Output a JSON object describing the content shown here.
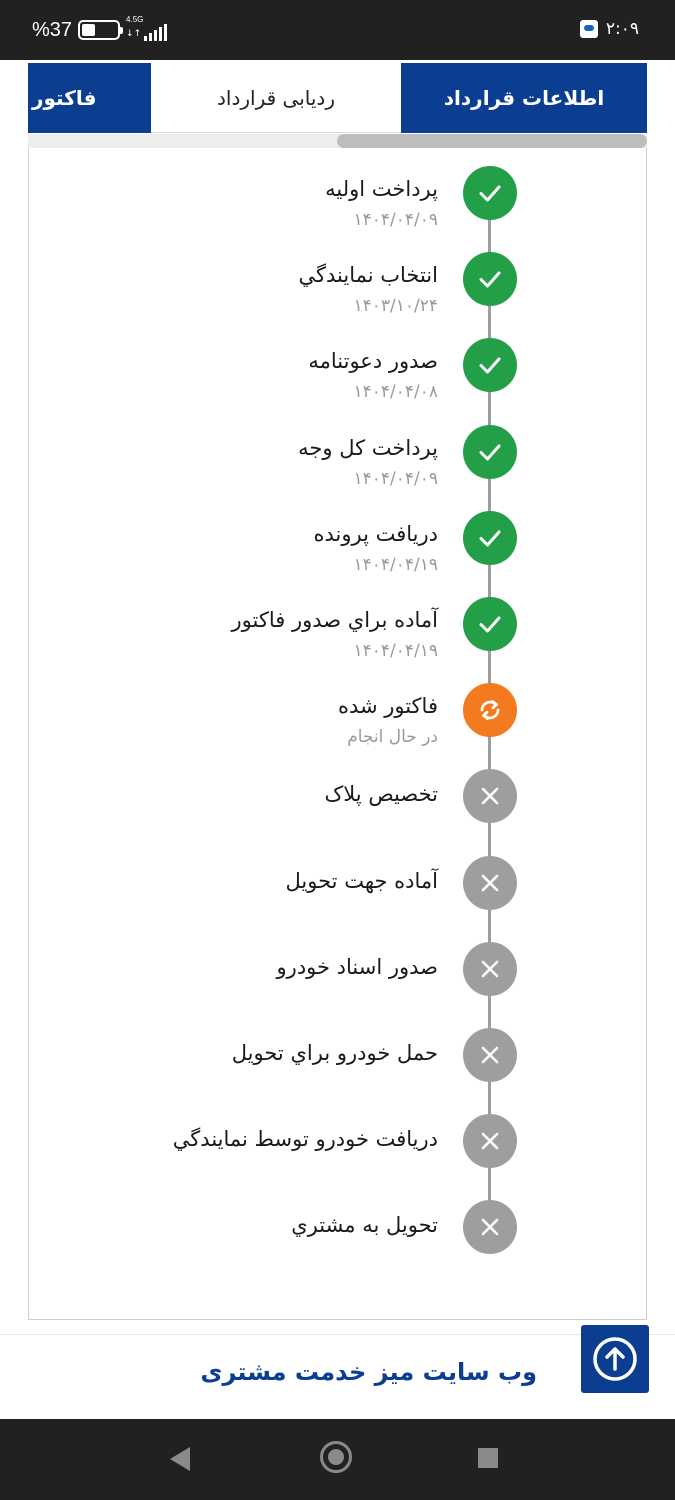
{
  "status_bar": {
    "battery_text": "%37",
    "battery_level": 0.37,
    "network_label": "4.5G",
    "network_arrows": "↓↑",
    "time": "۲:۰۹"
  },
  "tabs": [
    {
      "label": "اطلاعات قرارداد",
      "active": false
    },
    {
      "label": "ردیابی قرارداد",
      "active": true
    },
    {
      "label": "فاکتور",
      "active": false
    }
  ],
  "timeline": [
    {
      "title": "پرداخت اوليه",
      "subtitle": "۱۴۰۴/۰۴/۰۹",
      "status": "done"
    },
    {
      "title": "انتخاب نمايندگي",
      "subtitle": "۱۴۰۳/۱۰/۲۴",
      "status": "done"
    },
    {
      "title": "صدور دعوتنامه",
      "subtitle": "۱۴۰۴/۰۴/۰۸",
      "status": "done"
    },
    {
      "title": "پرداخت کل وجه",
      "subtitle": "۱۴۰۴/۰۴/۰۹",
      "status": "done"
    },
    {
      "title": "دريافت پرونده",
      "subtitle": "۱۴۰۴/۰۴/۱۹",
      "status": "done"
    },
    {
      "title": "آماده براي صدور فاکتور",
      "subtitle": "۱۴۰۴/۰۴/۱۹",
      "status": "done"
    },
    {
      "title": "فاکتور شده",
      "subtitle": "در حال انجام",
      "status": "in-progress"
    },
    {
      "title": "تخصيص پلاک",
      "subtitle": "",
      "status": "pending"
    },
    {
      "title": "آماده جهت تحويل",
      "subtitle": "",
      "status": "pending"
    },
    {
      "title": "صدور اسناد خودرو",
      "subtitle": "",
      "status": "pending"
    },
    {
      "title": "حمل خودرو براي تحويل",
      "subtitle": "",
      "status": "pending"
    },
    {
      "title": "دريافت خودرو توسط نمايندگي",
      "subtitle": "",
      "status": "pending"
    },
    {
      "title": "تحويل به مشتري",
      "subtitle": "",
      "status": "pending"
    }
  ],
  "footer": {
    "link_label": "وب سایت میز خدمت مشتری",
    "scroll_top_icon": "arrow-up-circle-icon"
  },
  "colors": {
    "brand_blue": "#0b3d91",
    "done_green": "#23a047",
    "progress_orange": "#f37a1f",
    "pending_gray": "#9e9e9e"
  }
}
